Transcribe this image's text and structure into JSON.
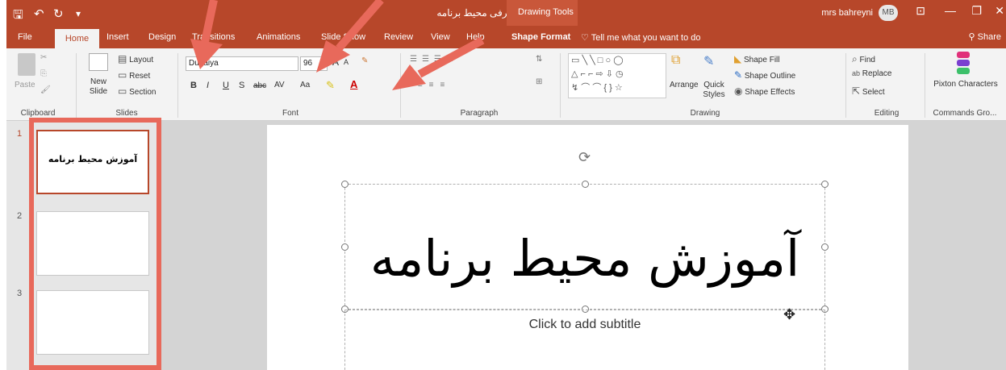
{
  "titlebar": {
    "qat_save": "🖫",
    "qat_undo": "↶",
    "qat_redo": "↻",
    "qat_custom": "▾",
    "title": "معرفی محیط برنامه - PowerPoint",
    "context_label": "Drawing Tools",
    "user_name": "mrs bahreyni",
    "avatar": "MB",
    "ribbon_display": "⊡",
    "minimize": "—",
    "restore": "❐",
    "close": "✕"
  },
  "tabs": {
    "file": "File",
    "home": "Home",
    "insert": "Insert",
    "design": "Design",
    "transitions": "Transitions",
    "animations": "Animations",
    "slideshow": "Slide Show",
    "review": "Review",
    "view": "View",
    "help": "Help",
    "shape_format": "Shape Format",
    "tell_me": "Tell me what you want to do",
    "share": "Share"
  },
  "ribbon": {
    "clipboard": {
      "paste": "Paste",
      "label": "Clipboard"
    },
    "slides": {
      "new_slide": "New Slide",
      "layout": "Layout",
      "reset": "Reset",
      "section": "Section",
      "label": "Slides"
    },
    "font": {
      "font_name": "Dubaiya",
      "font_size": "96",
      "bold": "B",
      "italic": "I",
      "underline": "U",
      "shadow": "S",
      "strike": "abc",
      "spacing": "AV",
      "case": "Aa",
      "grow": "A",
      "shrink": "A",
      "label": "Font"
    },
    "paragraph": {
      "label": "Paragraph"
    },
    "drawing": {
      "arrange": "Arrange",
      "quick_styles": "Quick Styles",
      "shape_fill": "Shape Fill",
      "shape_outline": "Shape Outline",
      "shape_effects": "Shape Effects",
      "label": "Drawing"
    },
    "editing": {
      "find": "Find",
      "replace": "Replace",
      "select": "Select",
      "label": "Editing"
    },
    "commands": {
      "pixton": "Pixton Characters",
      "label": "Commands Gro..."
    }
  },
  "slides": [
    {
      "number": "1",
      "title": "آموزش محیط برنامه"
    },
    {
      "number": "2",
      "title": ""
    },
    {
      "number": "3",
      "title": ""
    }
  ],
  "canvas": {
    "title_text": "آموزش محیط برنامه",
    "subtitle_placeholder": "Click to add subtitle"
  },
  "colors": {
    "accent": "#b7472a",
    "annotation": "#e8695b"
  }
}
